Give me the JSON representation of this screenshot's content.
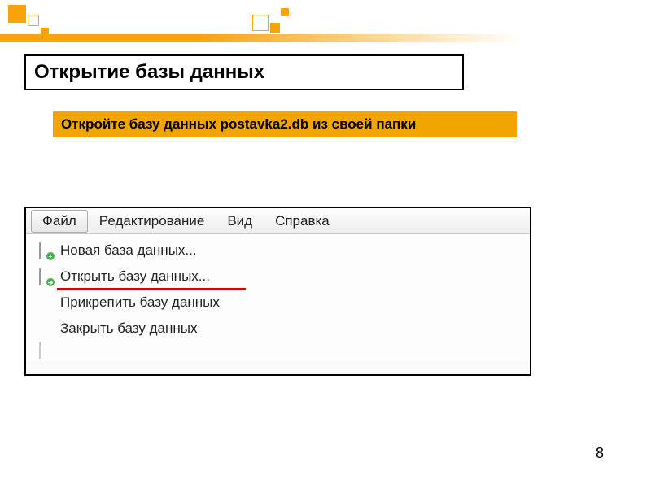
{
  "title": "Открытие базы данных",
  "instruction": "Откройте базу данных  postavka2.db из своей папки",
  "menu": {
    "items": [
      "Файл",
      "Редактирование",
      "Вид",
      "Справка"
    ]
  },
  "dropdown": {
    "items": [
      {
        "label": "Новая база данных...",
        "icon": "db-new"
      },
      {
        "label": "Открыть базу данных...",
        "icon": "db-open",
        "highlighted": true
      },
      {
        "label": "Прикрепить базу данных",
        "icon": ""
      },
      {
        "label": "Закрыть базу данных",
        "icon": ""
      }
    ]
  },
  "pageNumber": "8"
}
